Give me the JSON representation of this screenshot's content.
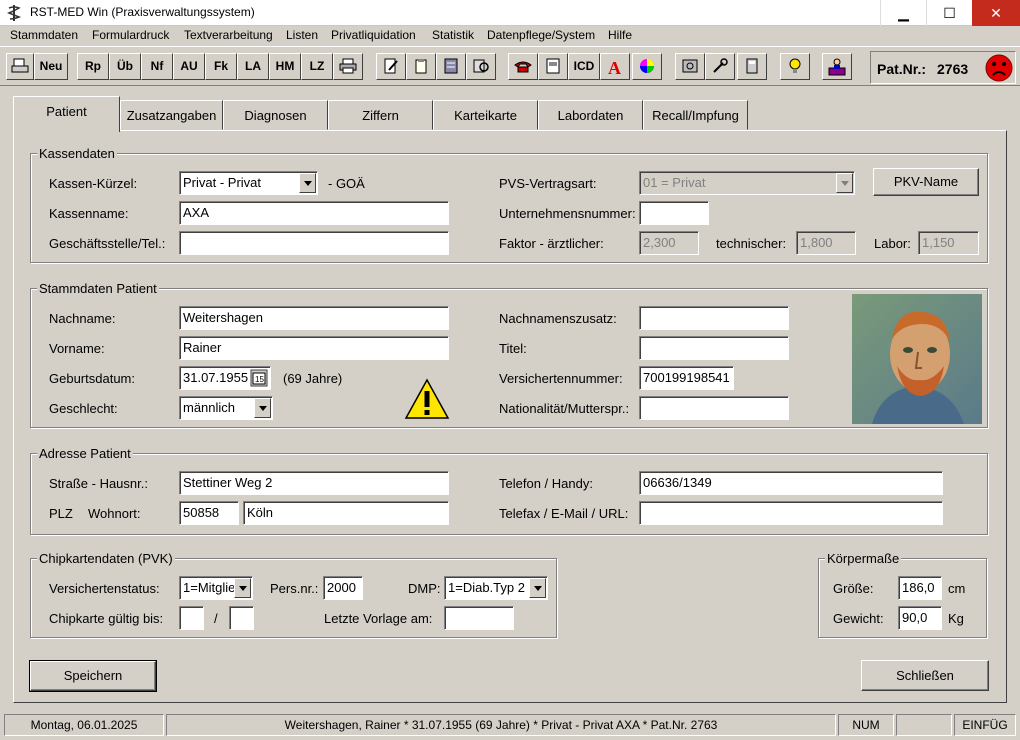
{
  "window": {
    "title": "RST-MED Win (Praxisverwaltungssystem)",
    "min": "▁",
    "max": "☐",
    "close": "✕"
  },
  "menu": [
    "Stammdaten",
    "Formulardruck",
    "Textverarbeitung",
    "Listen",
    "Privatliquidation",
    "Statistik",
    "Datenpflege/System",
    "Hilfe"
  ],
  "toolbar": {
    "neu": "Neu",
    "rp": "Rp",
    "ub": "Üb",
    "nf": "Nf",
    "au": "AU",
    "fk": "Fk",
    "la": "LA",
    "hm": "HM",
    "lz": "LZ",
    "icd": "ICD",
    "patnr_label": "Pat.Nr.:",
    "patnr_value": "2763"
  },
  "tabs": [
    "Patient",
    "Zusatzangaben",
    "Diagnosen",
    "Ziffern",
    "Karteikarte",
    "Labordaten",
    "Recall/Impfung"
  ],
  "kassen": {
    "legend": "Kassendaten",
    "kuerzel_label": "Kassen-Kürzel:",
    "kuerzel_value": "Privat - Privat",
    "goa": "- GOÄ",
    "name_label": "Kassenname:",
    "name_value": "AXA",
    "geschaeft_label": "Geschäftsstelle/Tel.:",
    "geschaeft_value": "",
    "pvs_label": "PVS-Vertragsart:",
    "pvs_value": "01 = Privat",
    "pkv_button": "PKV-Name",
    "unternehmen_label": "Unternehmensnummer:",
    "unternehmen_value": "",
    "faktor_label": "Faktor - ärztlicher:",
    "faktor_value": "2,300",
    "technisch_label": "technischer:",
    "technisch_value": "1,800",
    "labor_label": "Labor:",
    "labor_value": "1,150"
  },
  "stamm": {
    "legend": "Stammdaten Patient",
    "nachname_label": "Nachname:",
    "nachname_value": "Weitershagen",
    "vorname_label": "Vorname:",
    "vorname_value": "Rainer",
    "geburt_label": "Geburtsdatum:",
    "geburt_value": "31.07.1955",
    "alter": "(69 Jahre)",
    "geschlecht_label": "Geschlecht:",
    "geschlecht_value": "männlich",
    "zusatz_label": "Nachnamenszusatz:",
    "zusatz_value": "",
    "titel_label": "Titel:",
    "titel_value": "",
    "versnr_label": "Versichertennummer:",
    "versnr_value": "700199198541",
    "nation_label": "Nationalität/Mutterspr.:",
    "nation_value": ""
  },
  "adresse": {
    "legend": "Adresse Patient",
    "strasse_label": "Straße - Hausnr.:",
    "strasse_value": "Stettiner Weg 2",
    "plz_label": "PLZ",
    "ort_label": "Wohnort:",
    "plz_value": "50858",
    "ort_value": "Köln",
    "telefon_label": "Telefon / Handy:",
    "telefon_value": "06636/1349",
    "fax_label": "Telefax / E-Mail / URL:",
    "fax_value": ""
  },
  "chip": {
    "legend": "Chipkartendaten (PVK)",
    "status_label": "Versichertenstatus:",
    "status_value": "1=Mitglie",
    "pers_label": "Pers.nr.:",
    "pers_value": "2000",
    "dmp_label": "DMP:",
    "dmp_value": "1=Diab.Typ 2",
    "gueltig_label": "Chipkarte gültig bis:",
    "gueltig_month": "",
    "slash": "/",
    "gueltig_year": "",
    "vorlage_label": "Letzte Vorlage am:",
    "vorlage_value": ""
  },
  "koerper": {
    "legend": "Körpermaße",
    "groesse_label": "Größe:",
    "groesse_value": "186,0",
    "groesse_unit": "cm",
    "gewicht_label": "Gewicht:",
    "gewicht_value": "90,0",
    "gewicht_unit": "Kg"
  },
  "actions": {
    "save": "Speichern",
    "close": "Schließen"
  },
  "statusbar": {
    "date": "Montag, 06.01.2025",
    "patient": "Weitershagen, Rainer * 31.07.1955 (69 Jahre)  *  Privat - Privat AXA  *  Pat.Nr. 2763",
    "num": "NUM",
    "empty": "",
    "mode": "EINFÜG"
  },
  "colors": {
    "accent_red": "#e00000",
    "warning_yellow": "#ffe600"
  }
}
